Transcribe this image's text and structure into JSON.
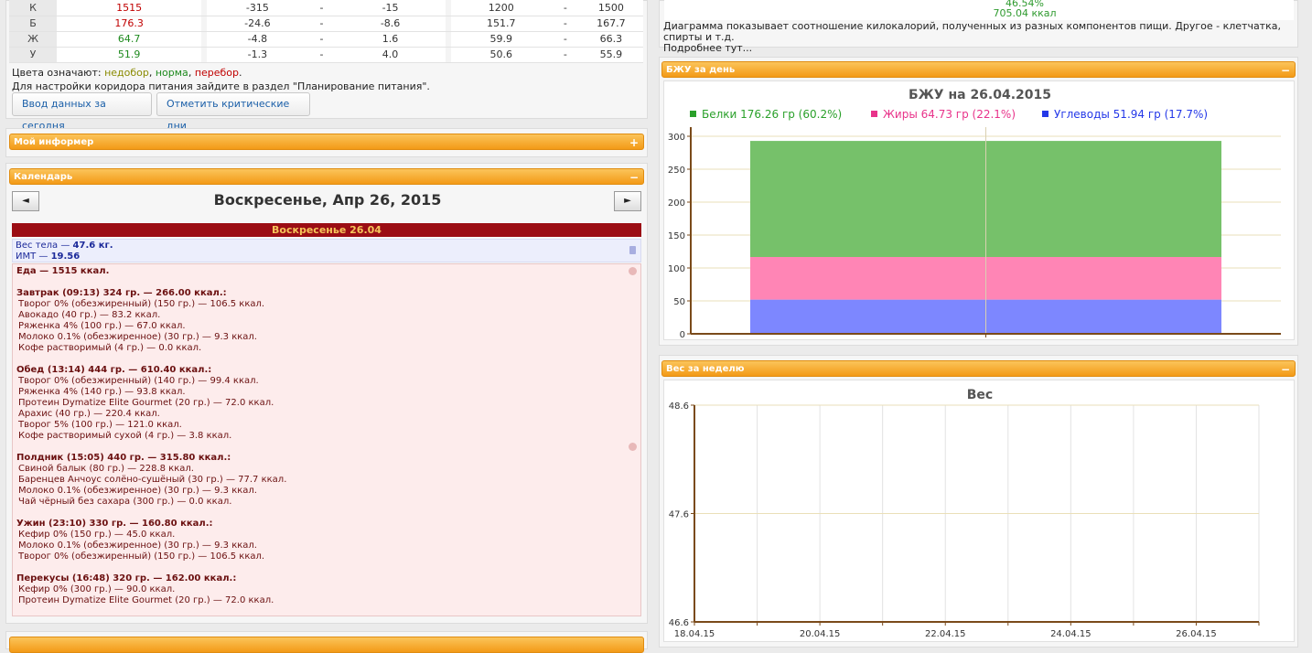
{
  "nutrients": [
    {
      "label": "К",
      "value": "1515",
      "class": "c-high",
      "d1": "-315",
      "d2": "-15",
      "n1": "1200",
      "n2": "1500"
    },
    {
      "label": "Б",
      "value": "176.3",
      "class": "c-high",
      "d1": "-24.6",
      "d2": "-8.6",
      "n1": "151.7",
      "n2": "167.7"
    },
    {
      "label": "Ж",
      "value": "64.7",
      "class": "c-ok",
      "d1": "-4.8",
      "d2": "1.6",
      "n1": "59.9",
      "n2": "66.3"
    },
    {
      "label": "У",
      "value": "51.9",
      "class": "c-ok",
      "d1": "-1.3",
      "d2": "4.0",
      "n1": "50.6",
      "n2": "55.9"
    }
  ],
  "dash": "-",
  "legend": {
    "prefix": "Цвета означают: ",
    "low": "недобор",
    "comma1": ", ",
    "ok": "норма",
    "comma2": ", ",
    "high": "перебор",
    "end": "."
  },
  "hint": "Для настройки коридора питания зайдите в раздел \"Планирование питания\".",
  "buttons": {
    "enter_today": "Ввод данных за сегодня",
    "mark_critical": "Отметить критические дни"
  },
  "panels": {
    "informer": "Мой информер",
    "calendar": "Календарь",
    "bju_day": "БЖУ за день",
    "weight_week": "Вес за неделю",
    "plus": "+",
    "minus": "−"
  },
  "calendar": {
    "prev": "◄",
    "next": "►",
    "title": "Воскресенье, Апр 26, 2015",
    "day_bar": "Воскресенье 26.04",
    "weight_label": "Вес тела — ",
    "weight_value": "47.6 кг.",
    "bmi_label": "ИМТ — ",
    "bmi_value": "19.56",
    "food_total": "Еда — 1515 ккал.",
    "meals": [
      {
        "title": "Завтрак (09:13) 324 гр. — 266.00 ккал.:",
        "items": [
          "Творог 0% (обезжиренный) (150 гр.) — 106.5 ккал.",
          "Авокадо (40 гр.) — 83.2 ккал.",
          "Ряженка 4% (100 гр.) — 67.0 ккал.",
          "Молоко 0.1% (обезжиренное) (30 гр.) — 9.3 ккал.",
          "Кофе растворимый (4 гр.) — 0.0 ккал."
        ]
      },
      {
        "title": "Обед (13:14) 444 гр. — 610.40 ккал.:",
        "items": [
          "Творог 0% (обезжиренный) (140 гр.) — 99.4 ккал.",
          "Ряженка 4% (140 гр.) — 93.8 ккал.",
          "Протеин Dymatize Elite Gourmet (20 гр.) — 72.0 ккал.",
          "Арахис (40 гр.) — 220.4 ккал.",
          "Творог 5% (100 гр.) — 121.0 ккал.",
          "Кофе растворимый сухой (4 гр.) — 3.8 ккал."
        ]
      },
      {
        "title": "Полдник (15:05) 440 гр. — 315.80 ккал.:",
        "items": [
          "Свиной балык (80 гр.) — 228.8 ккал.",
          "Баренцев Анчоус солёно-сушёный (30 гр.) — 77.7 ккал.",
          "Молоко 0.1% (обезжиренное) (30 гр.) — 9.3 ккал.",
          "Чай чёрный без сахара (300 гр.) — 0.0 ккал."
        ]
      },
      {
        "title": "Ужин (23:10) 330 гр. — 160.80 ккал.:",
        "items": [
          "Кефир 0% (150 гр.) — 45.0 ккал.",
          "Молоко 0.1% (обезжиренное) (30 гр.) — 9.3 ккал.",
          "Творог 0% (обезжиренный) (150 гр.) — 106.5 ккал."
        ]
      },
      {
        "title": "Перекусы (16:48) 320 гр. — 162.00 ккал.:",
        "items": [
          "Кефир 0% (300 гр.) — 90.0 ккал.",
          "Протеин Dymatize Elite Gourmet (20 гр.) — 72.0 ккал."
        ]
      }
    ]
  },
  "pie_partial": {
    "percent": "46.54%",
    "kcal": "705.04 ккал"
  },
  "diagram_note": "Диаграмма показывает соотношение килокалорий, полученных из разных компонентов пищи. Другое - клетчатка, спирты и т.д.",
  "diagram_more": "Подробнее тут...",
  "chart_data": [
    {
      "type": "bar",
      "title": "БЖУ на 26.04.2015",
      "stacked": true,
      "series": [
        {
          "name": "Белки 176.26 гр (60.2%)",
          "value": 176.26,
          "color": "#76c16a"
        },
        {
          "name": "Жиры 64.73 гр (22.1%)",
          "value": 64.73,
          "color": "#ff85b5"
        },
        {
          "name": "Углеводы 51.94 гр (17.7%)",
          "value": 51.94,
          "color": "#7d87ff"
        }
      ],
      "legend_colors": [
        "#2aa02a",
        "#e8338a",
        "#2438e8"
      ],
      "ylim": [
        0,
        300
      ],
      "yticks": [
        "0",
        "50",
        "100",
        "150",
        "200",
        "250",
        "300"
      ],
      "grid": true
    },
    {
      "type": "line",
      "title": "Вес",
      "ylim": [
        46.6,
        48.6
      ],
      "yticks": [
        "48.6",
        "47.6",
        "46.6"
      ],
      "xticks": [
        "18.04.15",
        "20.04.15",
        "22.04.15",
        "24.04.15",
        "26.04.15"
      ],
      "grid": true
    }
  ]
}
